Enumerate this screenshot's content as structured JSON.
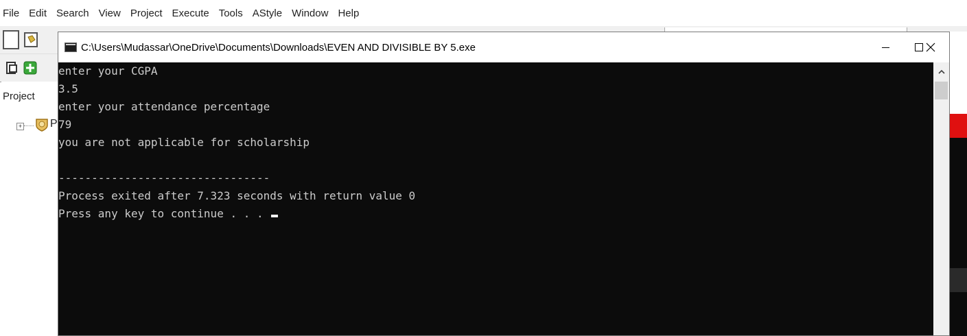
{
  "ide": {
    "menu": [
      "File",
      "Edit",
      "Search",
      "View",
      "Project",
      "Execute",
      "Tools",
      "AStyle",
      "Window",
      "Help"
    ],
    "panel_tab": "Project",
    "tree_item_label": "P"
  },
  "console": {
    "title": "C:\\Users\\Mudassar\\OneDrive\\Documents\\Downloads\\EVEN AND DIVISIBLE BY 5.exe",
    "lines": [
      "enter your CGPA",
      "3.5",
      "enter your attendance percentage",
      "79",
      "you are not applicable for scholarship",
      "",
      "--------------------------------",
      "Process exited after 7.323 seconds with return value 0",
      "Press any key to continue . . . "
    ]
  },
  "colors": {
    "console_bg": "#0c0c0c",
    "console_text": "#cccccc",
    "accent_red": "#e01010"
  },
  "icons": [
    "new-file-icon",
    "open-icon",
    "console-app-icon",
    "minimize-icon",
    "maximize-icon",
    "close-icon",
    "scroll-up-arrow-icon",
    "project-icon",
    "tree-expand-icon"
  ]
}
